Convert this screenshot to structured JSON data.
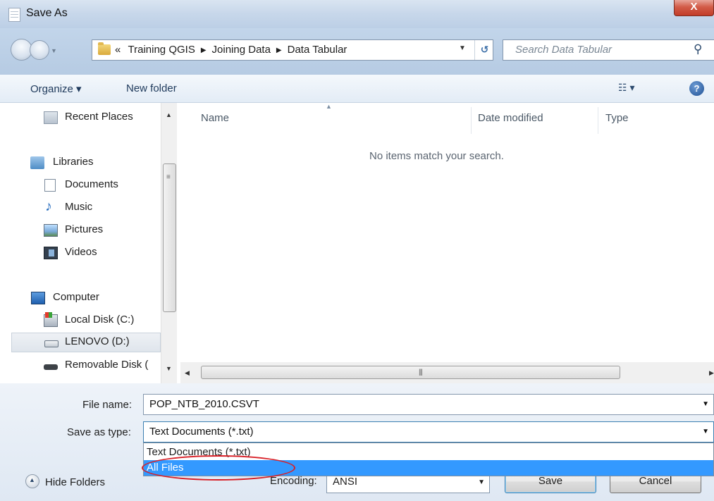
{
  "window": {
    "title": "Save As",
    "close_label": "X"
  },
  "address": {
    "overflow": "«",
    "crumbs": [
      "Training QGIS",
      "Joining Data",
      "Data Tabular"
    ],
    "search_placeholder": "Search Data Tabular"
  },
  "toolbar": {
    "organize": "Organize ▾",
    "new_folder": "New folder",
    "views": "☷ ▾",
    "help": "?"
  },
  "sidebar": {
    "items": [
      {
        "label": "Recent Places",
        "icon": "recent-places-icon"
      },
      {
        "label": "Libraries",
        "icon": "libraries-icon"
      },
      {
        "label": "Documents",
        "icon": "documents-icon"
      },
      {
        "label": "Music",
        "icon": "music-icon"
      },
      {
        "label": "Pictures",
        "icon": "pictures-icon"
      },
      {
        "label": "Videos",
        "icon": "videos-icon"
      },
      {
        "label": "Computer",
        "icon": "computer-icon"
      },
      {
        "label": "Local Disk (C:)",
        "icon": "local-disk-icon"
      },
      {
        "label": "LENOVO (D:)",
        "icon": "drive-icon",
        "selected": true
      },
      {
        "label": "Removable Disk (",
        "icon": "removable-disk-icon"
      }
    ]
  },
  "filelist": {
    "columns": [
      "Name",
      "Date modified",
      "Type"
    ],
    "empty_message": "No items match your search."
  },
  "form": {
    "file_name_label": "File name:",
    "file_name_value": "POP_NTB_2010.CSVT",
    "save_type_label": "Save as type:",
    "save_type_value": "Text Documents (*.txt)",
    "type_options": [
      "Text Documents (*.txt)",
      "All Files"
    ],
    "selected_option": "All Files",
    "encoding_label": "Encoding:",
    "encoding_value": "ANSI",
    "hide_folders": "Hide Folders",
    "save_button": "Save",
    "cancel_button": "Cancel"
  },
  "colors": {
    "selection": "#3399ff",
    "annotation": "#d81f26"
  }
}
